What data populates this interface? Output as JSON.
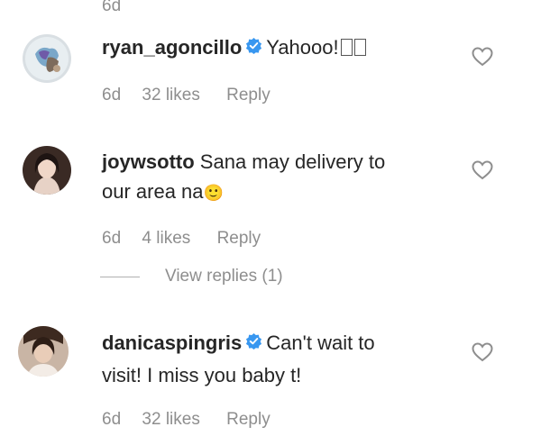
{
  "top": {
    "time": "6d"
  },
  "comments": [
    {
      "username": "ryan_agoncillo",
      "verified": true,
      "text": "Yahooo!",
      "trailing_glyph_count": 2,
      "time": "6d",
      "likes": "32 likes",
      "reply": "Reply"
    },
    {
      "username": "joywsotto",
      "verified": false,
      "text_line1": "Sana may delivery to",
      "text_line2": "our area na",
      "emoji": "🙂",
      "time": "6d",
      "likes": "4 likes",
      "reply": "Reply",
      "view_replies": "View replies (1)"
    },
    {
      "username": "danicaspingris",
      "verified": true,
      "text_line1": "Can't wait to",
      "text_line2": "visit! I miss you baby t!",
      "time": "6d",
      "likes": "32 likes",
      "reply": "Reply"
    }
  ],
  "colors": {
    "text": "#262626",
    "meta": "#8e8e8e",
    "verified": "#3897f0",
    "heart": "#8e8e8e"
  },
  "icons": {
    "like": "heart-icon",
    "verified": "verified-badge-icon"
  }
}
